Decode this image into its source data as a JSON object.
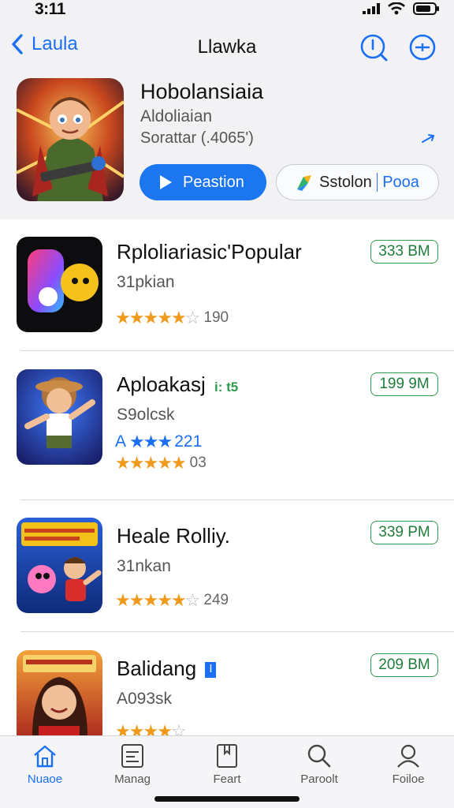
{
  "status_bar": {
    "time": "3:11"
  },
  "nav": {
    "back_label": "Laula",
    "title": "Llawka",
    "icons": [
      "info-search-icon",
      "more-icon"
    ]
  },
  "featured": {
    "title": "Hobolansiaia",
    "subtitle": "Aldoliaian",
    "meta": "Sorattar (.4065')",
    "primary_button": "Peastion",
    "secondary_button_left": "Sstolon",
    "secondary_button_right": "Pooa"
  },
  "apps": [
    {
      "title": "Rploliariasic'Popular",
      "subtitle": "31pkian",
      "rating": 4.5,
      "rating_count": "190",
      "size": "333 BM"
    },
    {
      "title": "Aploakasj",
      "tag": "i: t5",
      "subtitle": "S9olcsk",
      "alt_rating_prefix": "A",
      "alt_rating_count": "221",
      "rating": 5,
      "rating_count": "03",
      "size": "199 9M"
    },
    {
      "title": "Heale Rolliy.",
      "subtitle": "31nkan",
      "rating": 4.5,
      "rating_count": "249",
      "size": "339 PM"
    },
    {
      "title": "Balidang",
      "tag": "I",
      "subtitle": "A093sk",
      "rating": 4,
      "size": "209 BM"
    }
  ],
  "tabs": [
    {
      "label": "Nuaoe",
      "icon": "home-icon",
      "active": true
    },
    {
      "label": "Manag",
      "icon": "list-icon",
      "active": false
    },
    {
      "label": "Feart",
      "icon": "bookmark-icon",
      "active": false
    },
    {
      "label": "Paroolt",
      "icon": "search-icon",
      "active": false
    },
    {
      "label": "Foiloe",
      "icon": "profile-icon",
      "active": false
    }
  ],
  "colors": {
    "accent": "#1b76ef",
    "size_badge": "#2e9b4d",
    "star": "#f09a1c"
  }
}
